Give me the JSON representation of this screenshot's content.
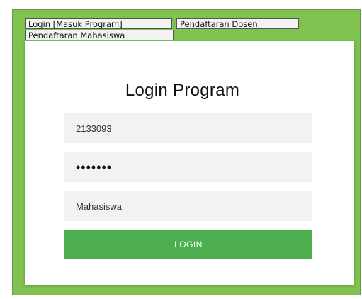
{
  "tabs": {
    "login": "Login [Masuk Program]",
    "dosen": "Pendaftaran Dosen",
    "mahasiswa": "Pendaftaran Mahasiswa"
  },
  "form": {
    "title": "Login Program",
    "username_value": "2133093",
    "password_value": "•••••••",
    "role_value": "Mahasiswa",
    "login_label": "LOGIN"
  },
  "colors": {
    "frame_green": "#7fc24f",
    "button_green": "#4cae4f",
    "field_bg": "#f2f2f2"
  }
}
